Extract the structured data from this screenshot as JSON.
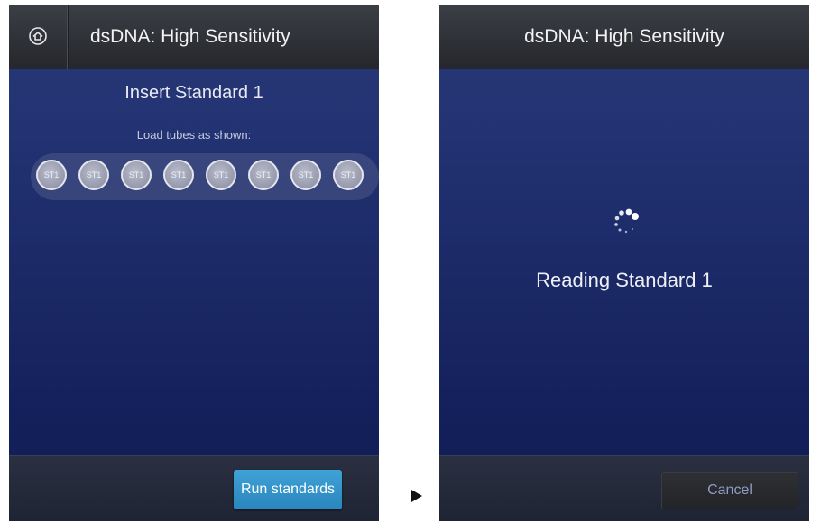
{
  "left_screen": {
    "title": "dsDNA: High Sensitivity",
    "instruction_title": "Insert Standard 1",
    "instruction_text": "Load tubes as shown:",
    "tubes": [
      "ST1",
      "ST1",
      "ST1",
      "ST1",
      "ST1",
      "ST1",
      "ST1",
      "ST1"
    ],
    "run_button_label": "Run standards",
    "icons": {
      "home": "home-icon"
    }
  },
  "right_screen": {
    "title": "dsDNA: High Sensitivity",
    "status_text": "Reading Standard 1",
    "cancel_button_label": "Cancel",
    "icons": {
      "loading": "loading-spinner-icon"
    }
  },
  "flow": {
    "icon": "play-arrow-icon"
  },
  "colors": {
    "screen_top": "#2a3a78",
    "screen_bottom": "#101c52",
    "header": "#2f3238",
    "run_button": "#2f92c8",
    "cancel_text": "#8f9cc4"
  }
}
